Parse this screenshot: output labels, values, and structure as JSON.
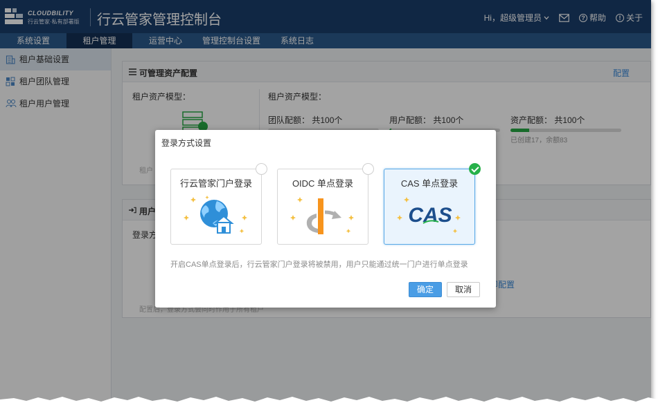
{
  "header": {
    "logo_en": "CLOUDBILITY",
    "logo_cn": "行云管家·私有部署版",
    "title": "行云管家管理控制台",
    "greeting": "Hi，超级管理员",
    "mail_icon": "mail-icon",
    "help_label": "帮助",
    "about_label": "关于"
  },
  "nav": {
    "items": [
      {
        "label": "系统设置"
      },
      {
        "label": "租户管理"
      },
      {
        "label": "运营中心"
      },
      {
        "label": "管理控制台设置"
      },
      {
        "label": "系统日志"
      }
    ],
    "active_index": 1
  },
  "sidebar": {
    "items": [
      {
        "label": "租户基础设置",
        "icon": "building-icon"
      },
      {
        "label": "租户团队管理",
        "icon": "team-grid-icon"
      },
      {
        "label": "租户用户管理",
        "icon": "users-icon"
      }
    ],
    "active_index": 0
  },
  "asset_panel": {
    "title": "可管理资产配置",
    "config_link": "配置",
    "left_label": "租户资产模型：",
    "right_label": "租户资产模型：",
    "left_hint": "租户",
    "quotas": [
      {
        "label": "团队配额：",
        "value": "共100个",
        "fill": 0.0
      },
      {
        "label": "用户配额：",
        "value": "共100个",
        "fill": 0.02
      },
      {
        "label": "资产配额：",
        "value": "共100个",
        "fill": 0.17,
        "sub": "已创建17，余额83"
      }
    ]
  },
  "login_panel": {
    "title": "用户",
    "left_label": "登录方",
    "link_fragment": "即配置",
    "hint": "配置后，登录方式会同时作用于所有租户"
  },
  "modal": {
    "title": "登录方式设置",
    "options": [
      {
        "label": "行云管家门户登录",
        "art": "globe-home-icon",
        "selected": false
      },
      {
        "label": "OIDC 单点登录",
        "art": "openid-icon",
        "selected": false
      },
      {
        "label": "CAS 单点登录",
        "art": "cas-logo-icon",
        "logo_text": "CAS",
        "selected": true
      }
    ],
    "note": "开启CAS单点登录后，行云管家门户登录将被禁用，用户只能通过统一门户进行单点登录",
    "ok_label": "确定",
    "cancel_label": "取消"
  },
  "colors": {
    "header_bg": "#1a3d6b",
    "nav_bg": "#2b5a8c",
    "nav_active": "#142f55",
    "accent": "#4a9de5",
    "success": "#27b14a",
    "cas_blue": "#1c4e8c"
  }
}
